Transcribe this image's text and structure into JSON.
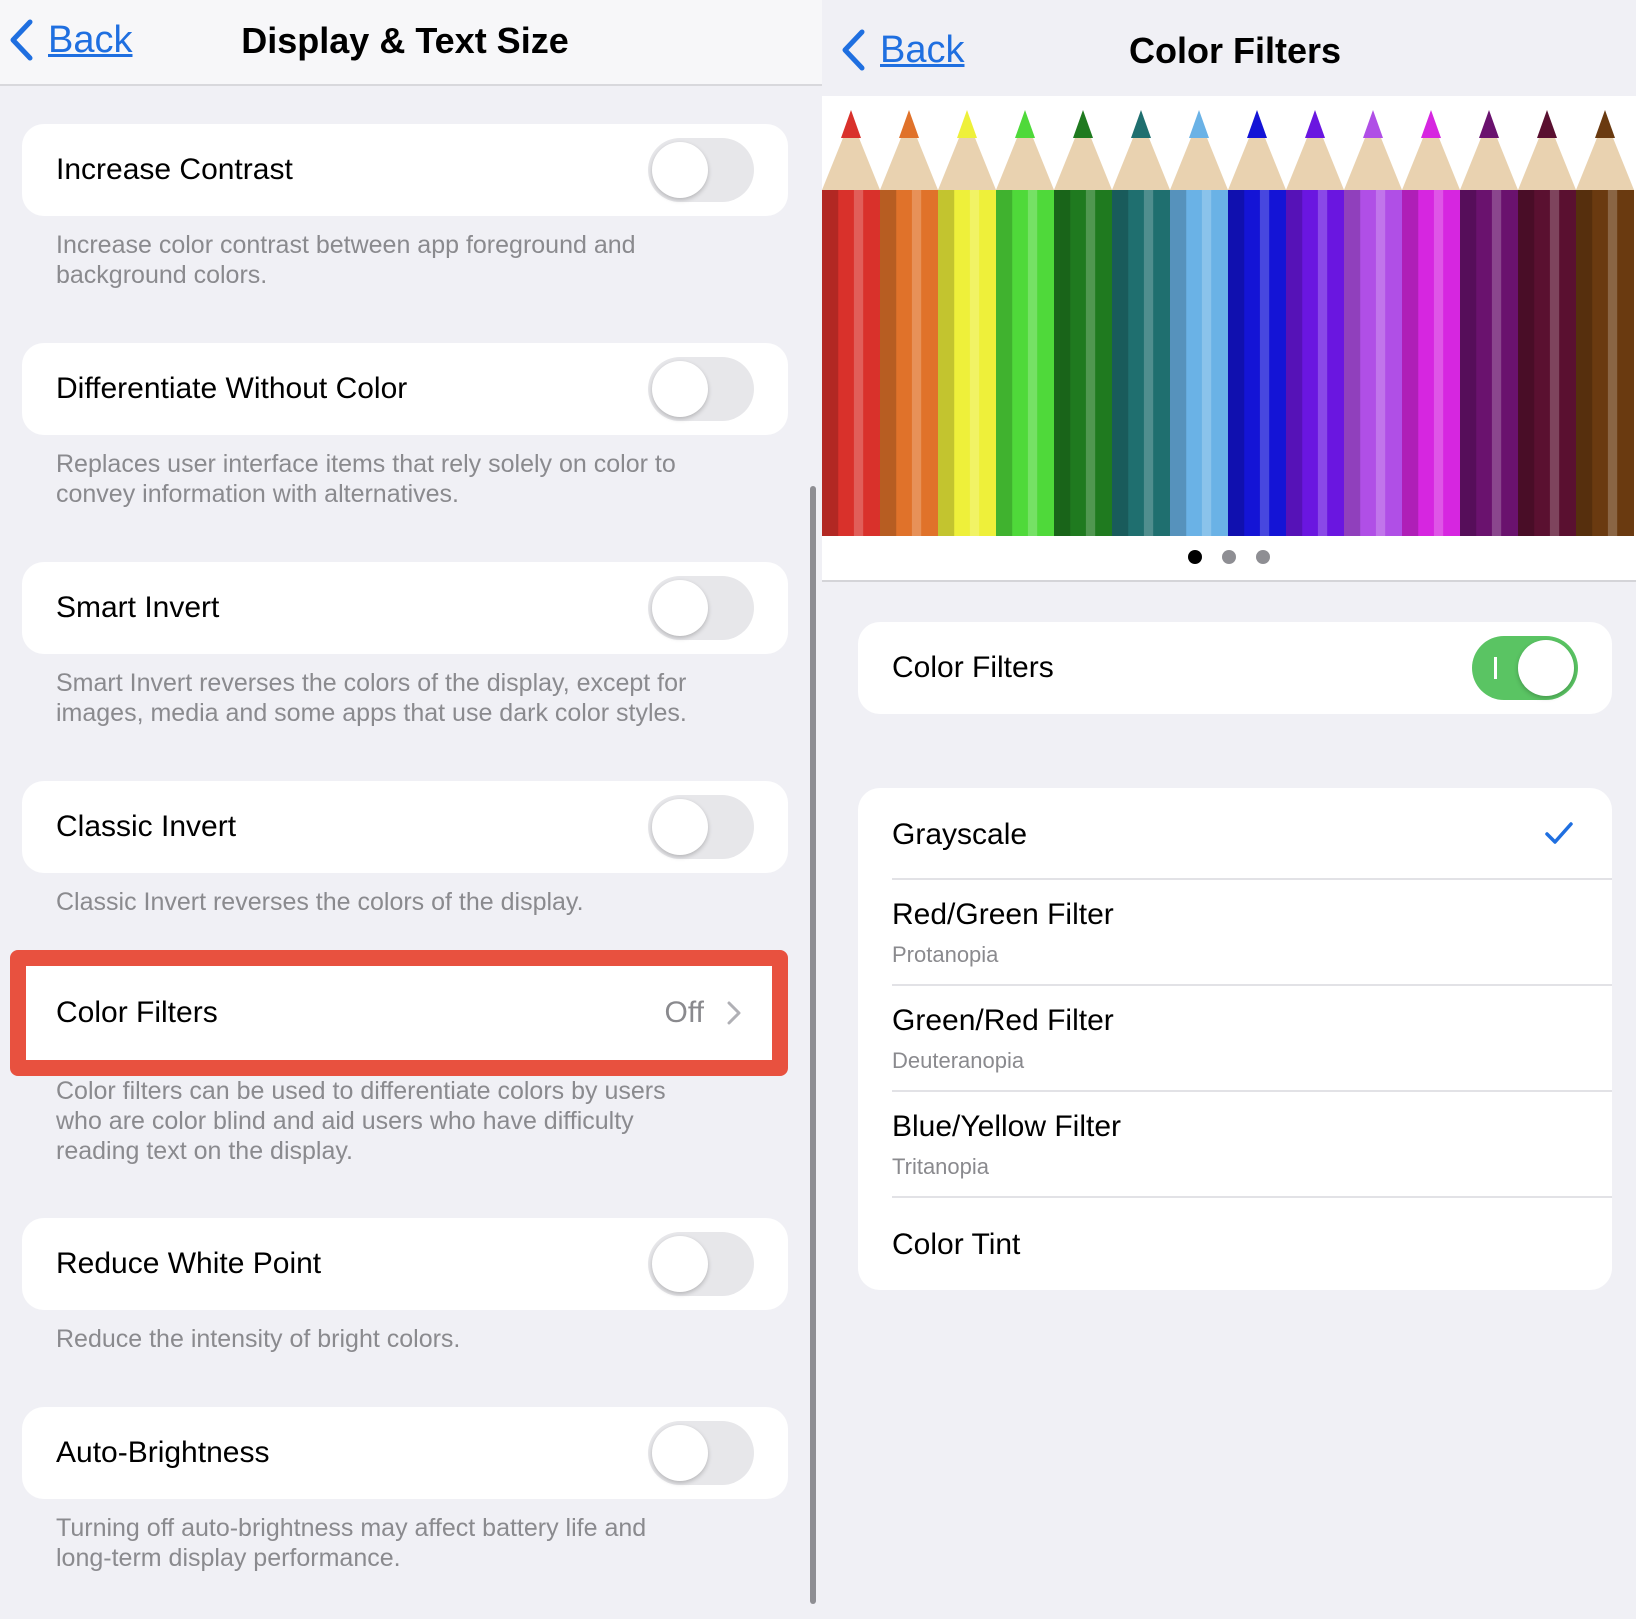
{
  "left": {
    "nav": {
      "back_label": "Back",
      "title": "Display & Text Size"
    },
    "settings": [
      {
        "label": "Increase Contrast",
        "enabled": false,
        "description": [
          "Increase color contrast between app foreground and",
          "background colors."
        ]
      },
      {
        "label": "Differentiate Without Color",
        "enabled": false,
        "description": [
          "Replaces user interface items that rely solely on color to",
          "convey information with alternatives."
        ]
      },
      {
        "label": "Smart Invert",
        "enabled": false,
        "description": [
          "Smart Invert reverses the colors of the display, except for",
          "images, media and some apps that use dark color styles."
        ]
      },
      {
        "label": "Classic Invert",
        "enabled": false,
        "description": [
          "Classic Invert reverses the colors of the display."
        ]
      },
      {
        "label": "Color Filters",
        "value": "Off",
        "description": [
          "Color filters can be used to differentiate colors by users",
          "who are color blind and aid users who have difficulty",
          "reading text on the display."
        ]
      },
      {
        "label": "Reduce White Point",
        "enabled": false,
        "description": [
          "Reduce the intensity of bright colors."
        ]
      },
      {
        "label": "Auto-Brightness",
        "enabled": false,
        "description": [
          "Turning off auto-brightness may affect battery life and",
          "long-term display performance."
        ]
      }
    ],
    "highlight_color": "#e8513f"
  },
  "right": {
    "nav": {
      "back_label": "Back",
      "title": "Color Filters"
    },
    "hero": {
      "image": "colored-pencils",
      "pencil_colors": [
        "#d9312b",
        "#e0722a",
        "#eef03a",
        "#4fd93a",
        "#1f7a1f",
        "#1f6f6f",
        "#6ab2e6",
        "#1414d6",
        "#6a16e0",
        "#b04fe6",
        "#d626e0",
        "#6a126e",
        "#5a1030",
        "#6a3a10"
      ],
      "page_count": 3,
      "current_page": 1
    },
    "toggle": {
      "label": "Color Filters",
      "enabled": true
    },
    "filters": [
      {
        "label": "Grayscale",
        "subtitle": "",
        "selected": true
      },
      {
        "label": "Red/Green Filter",
        "subtitle": "Protanopia",
        "selected": false
      },
      {
        "label": "Green/Red Filter",
        "subtitle": "Deuteranopia",
        "selected": false
      },
      {
        "label": "Blue/Yellow Filter",
        "subtitle": "Tritanopia",
        "selected": false
      },
      {
        "label": "Color Tint",
        "subtitle": "",
        "selected": false
      }
    ],
    "accent_color": "#1f6fe0",
    "toggle_on_color": "#5ac463"
  }
}
